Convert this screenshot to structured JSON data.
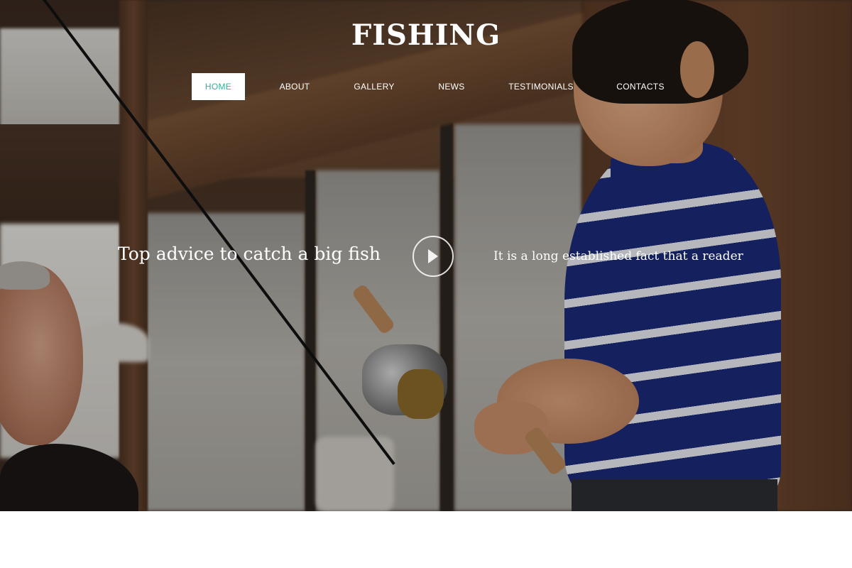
{
  "site": {
    "brand": "FISHING"
  },
  "nav": {
    "items": [
      {
        "label": "HOME",
        "active": true
      },
      {
        "label": "ABOUT",
        "active": false
      },
      {
        "label": "GALLERY",
        "active": false
      },
      {
        "label": "NEWS",
        "active": false
      },
      {
        "label": "TESTIMONIALS",
        "active": false
      },
      {
        "label": "CONTACTS",
        "active": false
      }
    ],
    "active_color": "#27b49b"
  },
  "hero": {
    "tagline": "Top advice to catch a big fish",
    "play_icon": "play-icon",
    "blurb": "It is a long established fact that a reader"
  }
}
